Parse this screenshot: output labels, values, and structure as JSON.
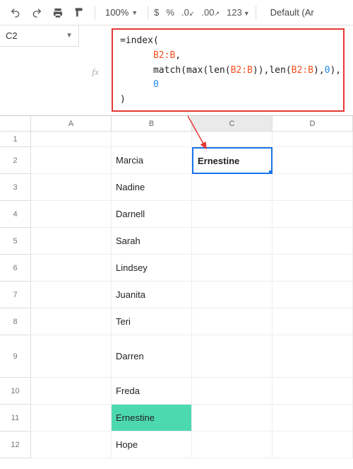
{
  "toolbar": {
    "zoom": "100%",
    "format_123": "123",
    "font": "Default (Ar"
  },
  "namebox": {
    "ref": "C2",
    "fx_label": "fx"
  },
  "formula": {
    "l1a": "=",
    "l1b": "index",
    "l1c": "(",
    "l2a": "B2:B",
    "l2b": ",",
    "l3a": "match",
    "l3b": "(",
    "l3c": "max",
    "l3d": "(",
    "l3e": "len",
    "l3f": "(",
    "l3g": "B2:B",
    "l3h": ")),",
    "l3i": "len",
    "l3j": "(",
    "l3k": "B2:B",
    "l3l": "),",
    "l3m": "0",
    "l3n": "),",
    "l4a": "0",
    "l5a": ")"
  },
  "columns": {
    "A": "A",
    "B": "B",
    "C": "C",
    "D": "D"
  },
  "rows": [
    {
      "n": "1",
      "b": "",
      "h": "sm"
    },
    {
      "n": "2",
      "b": "Marcia",
      "c": "Ernestine",
      "h": "std",
      "active": true
    },
    {
      "n": "3",
      "b": "Nadine",
      "h": "std"
    },
    {
      "n": "4",
      "b": "Darnell",
      "h": "std"
    },
    {
      "n": "5",
      "b": "Sarah",
      "h": "std"
    },
    {
      "n": "6",
      "b": "Lindsey",
      "h": "std"
    },
    {
      "n": "7",
      "b": "Juanita",
      "h": "std"
    },
    {
      "n": "8",
      "b": "Teri",
      "h": "std"
    },
    {
      "n": "9",
      "b": "Darren",
      "h": "lg"
    },
    {
      "n": "10",
      "b": "Freda",
      "h": "std"
    },
    {
      "n": "11",
      "b": "Ernestine",
      "h": "std",
      "hl": true
    },
    {
      "n": "12",
      "b": "Hope",
      "h": "std"
    }
  ]
}
